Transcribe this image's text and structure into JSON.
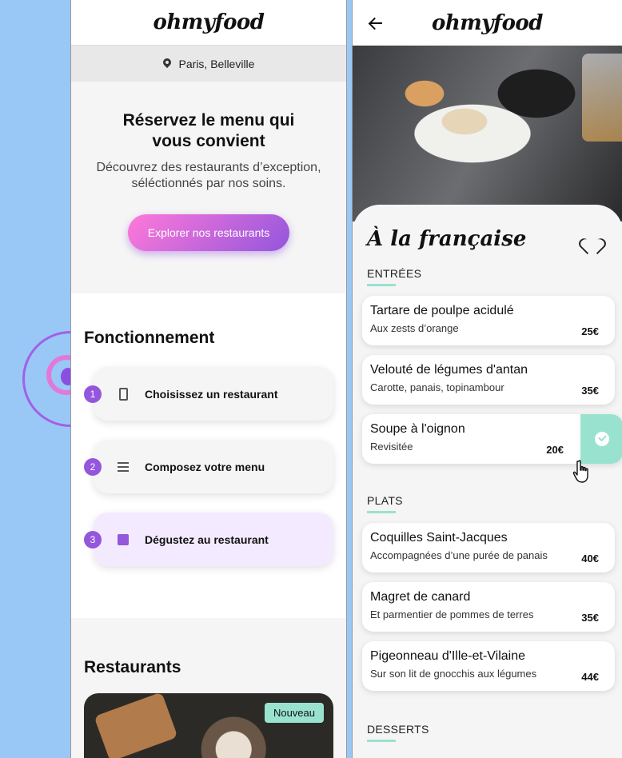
{
  "app": {
    "logo": "ohmyfood"
  },
  "home": {
    "location": "Paris, Belleville",
    "hero_title": "Réservez le menu qui vous convient",
    "hero_subtitle": "Découvrez des restaurants d’exception, séléctionnés par nos soins.",
    "explore_button": "Explorer nos restaurants",
    "how_title": "Fonctionnement",
    "steps": [
      {
        "number": "1",
        "label": "Choisissez un restaurant",
        "icon": "mobile-phone-icon"
      },
      {
        "number": "2",
        "label": "Composez votre menu",
        "icon": "list-icon"
      },
      {
        "number": "3",
        "label": "Dégustez au restaurant",
        "icon": "store-icon"
      }
    ],
    "restaurants_title": "Restaurants",
    "restaurant_badge": "Nouveau"
  },
  "menu": {
    "title": "À la française",
    "categories": [
      {
        "name": "ENTRÉES",
        "dishes": [
          {
            "name": "Tartare de poulpe acidulé",
            "desc": "Aux zests d’orange",
            "price": "25€"
          },
          {
            "name": "Velouté de légumes d'antan",
            "desc": "Carotte, panais, topinambour",
            "price": "35€"
          },
          {
            "name": "Soupe à l'oignon",
            "desc": "Revisitée",
            "price": "20€",
            "selected": true
          }
        ]
      },
      {
        "name": "PLATS",
        "dishes": [
          {
            "name": "Coquilles Saint-Jacques",
            "desc": "Accompagnées d’une purée de panais",
            "price": "40€"
          },
          {
            "name": "Magret de canard",
            "desc": "Et parmentier de pommes de terres",
            "price": "35€"
          },
          {
            "name": "Pigeonneau d'Ille-et-Vilaine",
            "desc": "Sur son lit de gnocchis aux légumes",
            "price": "44€"
          }
        ]
      },
      {
        "name": "DESSERTS",
        "dishes": []
      }
    ]
  },
  "colors": {
    "primary": "#9356dc",
    "secondary": "#ff79da",
    "tertiary": "#99e2d0",
    "background": "#99c8f7"
  }
}
